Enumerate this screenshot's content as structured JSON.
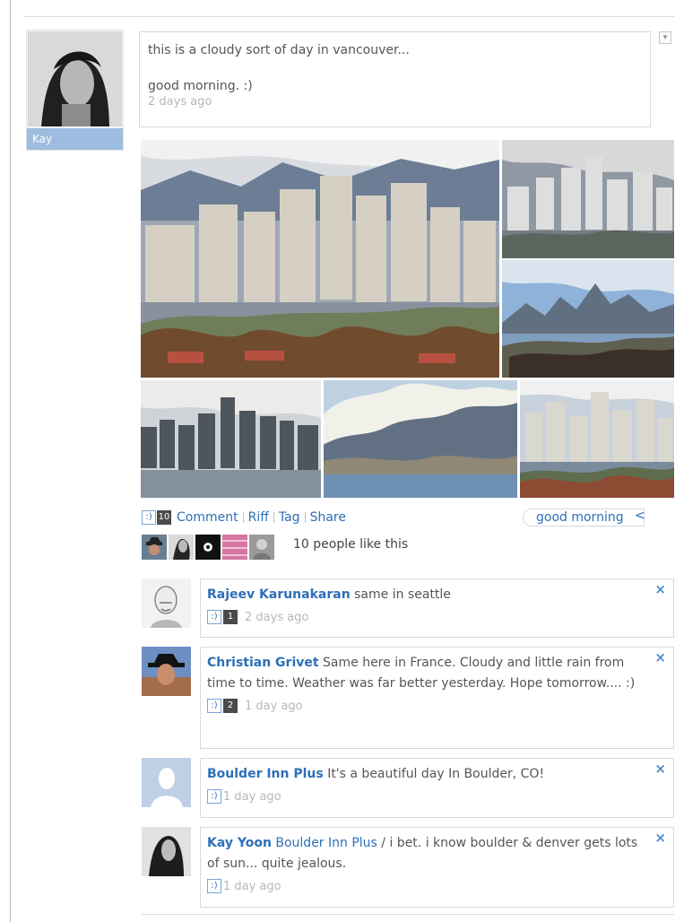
{
  "post": {
    "author": "Kay",
    "text": "this is a cloudy sort of day in vancouver...\n\ngood morning. :)",
    "time": "2 days ago"
  },
  "actions": {
    "smile": ":)",
    "count": "10",
    "comment": "Comment",
    "riff": "Riff",
    "tag": "Tag",
    "share": "Share"
  },
  "tag": {
    "label": "good morning",
    "arrow": "<"
  },
  "likes": {
    "text": "10 people like this"
  },
  "comments": [
    {
      "author": "Rajeev Karunakaran",
      "text": "same in seattle",
      "smile": ":)",
      "count": "1",
      "time": "2 days ago"
    },
    {
      "author": "Christian Grivet",
      "text": "Same here in France. Cloudy and little rain from time to time. Weather was far better yesterday. Hope tomorrow.... :)",
      "smile": ":)",
      "count": "2",
      "time": "1 day ago"
    },
    {
      "author": "Boulder Inn Plus",
      "text": "It's a beautiful day In Boulder, CO!",
      "smile": ":)",
      "time": "1 day ago"
    },
    {
      "author": "Kay Yoon",
      "mention": "Boulder Inn Plus",
      "text": "/ i bet. i know boulder & denver gets lots of sun... quite jealous.",
      "smile": ":)",
      "time": "1 day ago"
    }
  ],
  "colors": {
    "link_blue": "#2d6fb7",
    "name_bar": "#9dbce0",
    "border": "#d9d9d9"
  }
}
